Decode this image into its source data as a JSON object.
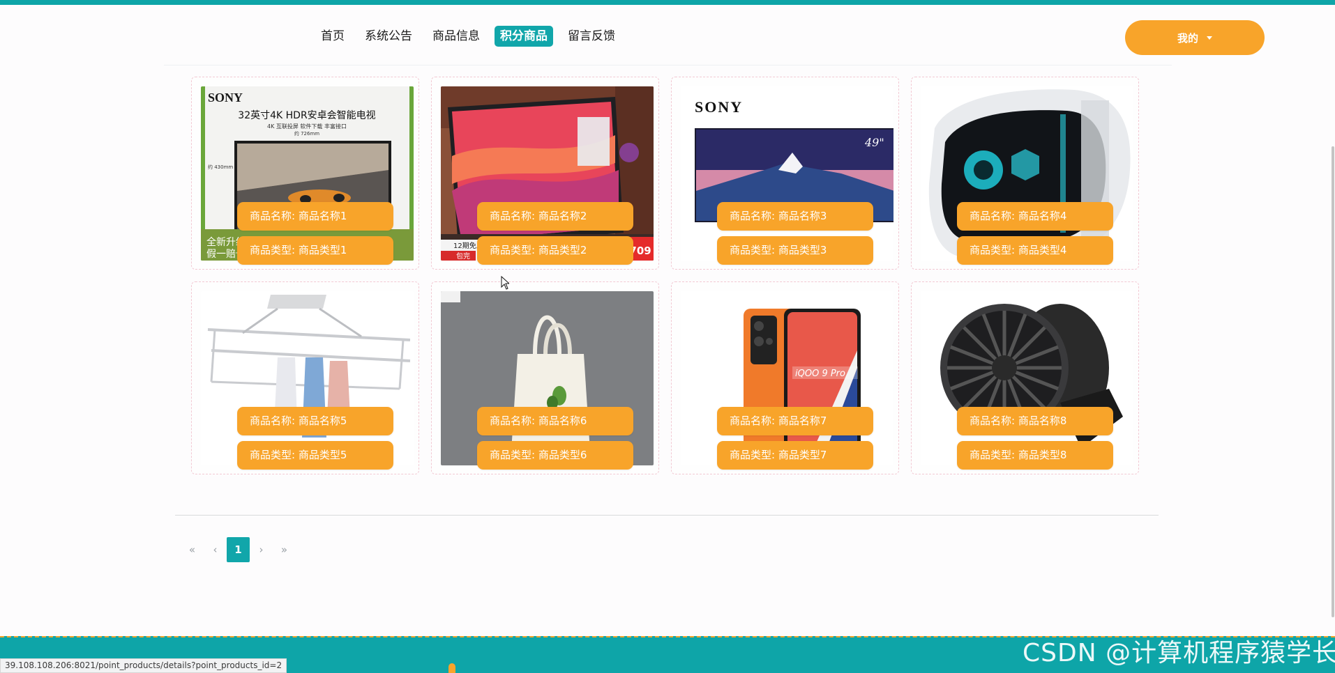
{
  "nav": {
    "items": [
      {
        "label": "首页",
        "active": false
      },
      {
        "label": "系统公告",
        "active": false
      },
      {
        "label": "商品信息",
        "active": false
      },
      {
        "label": "积分商品",
        "active": true
      },
      {
        "label": "留言反馈",
        "active": false
      }
    ],
    "user_menu_label": "我的"
  },
  "products": [
    {
      "name": "商品名称: 商品名称1",
      "type": "商品类型: 商品类型1",
      "image": "sony-tv-ad"
    },
    {
      "name": "商品名称: 商品名称2",
      "type": "商品类型: 商品类型2",
      "image": "desktop-monitor"
    },
    {
      "name": "商品名称: 商品名称3",
      "type": "商品类型: 商品类型3",
      "image": "sony-tv-mountain"
    },
    {
      "name": "商品名称: 商品名称4",
      "type": "商品类型: 商品类型4",
      "image": "gaming-pc"
    },
    {
      "name": "商品名称: 商品名称5",
      "type": "商品类型: 商品类型5",
      "image": "clothes-rack"
    },
    {
      "name": "商品名称: 商品名称6",
      "type": "商品类型: 商品类型6",
      "image": "tote-bag"
    },
    {
      "name": "商品名称: 商品名称7",
      "type": "商品类型: 商品类型7",
      "image": "smartphone"
    },
    {
      "name": "商品名称: 商品名称8",
      "type": "商品类型: 商品类型8",
      "image": "desk-fan"
    }
  ],
  "image_text": {
    "sony_brand": "SONY",
    "tv_title": "32英寸4K HDR安卓会智能电视",
    "tv_sub": "4K 互联投屏  软件下载  丰富接口",
    "tv_width": "约 726mm",
    "tv_height": "约 430mm",
    "tv_bottom_1": "全新升级",
    "tv_bottom_2": "假一赔十",
    "tv_size_49": "49\"",
    "monitor_promo": "12期免息",
    "monitor_price": "2709",
    "monitor_ship": "包完",
    "phone_brand": "iQOO 9 Pro"
  },
  "pagination": {
    "first": "«",
    "prev": "‹",
    "current": "1",
    "next": "›",
    "last": "»"
  },
  "status_url": "39.108.108.206:8021/point_products/details?point_products_id=2",
  "watermark": "CSDN @计算机程序猿学长",
  "colors": {
    "accent": "#0ea5a8",
    "orange": "#f8a42a"
  }
}
